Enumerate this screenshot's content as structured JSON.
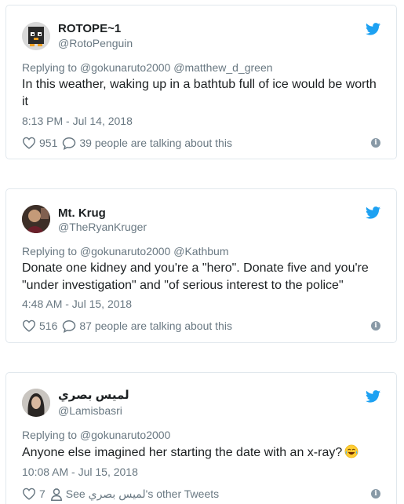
{
  "colors": {
    "twitter_blue": "#1da1f2",
    "gray": "#697882",
    "text": "#1c2022",
    "border": "#e1e8ed"
  },
  "tweets": [
    {
      "display_name": "ROTOPE~1",
      "handle": "@RotoPenguin",
      "replying": "Replying to @gokunaruto2000 @matthew_d_green",
      "text": "In this weather, waking up in a bathtub full of ice would be worth it",
      "timestamp": "8:13 PM - Jul 14, 2018",
      "likes": "951",
      "replies_label": "39 people are talking about this",
      "icons": [
        "heart-icon",
        "speech-bubble-icon",
        "info-icon",
        "twitter-bird-icon"
      ]
    },
    {
      "display_name": "Mt. Krug",
      "handle": "@TheRyanKruger",
      "replying": "Replying to @gokunaruto2000 @Kathbum",
      "text": "Donate one kidney and you're a \"hero\". Donate five and you're \"under investigation\" and \"of serious interest to the police\"",
      "timestamp": "4:48 AM - Jul 15, 2018",
      "likes": "516",
      "replies_label": "87 people are talking about this",
      "icons": [
        "heart-icon",
        "speech-bubble-icon",
        "info-icon",
        "twitter-bird-icon"
      ]
    },
    {
      "display_name": "لميس بصري",
      "handle": "@Lamisbasri",
      "replying": "Replying to @gokunaruto2000",
      "text": "Anyone else imagined her starting the date with an x-ray?",
      "timestamp": "10:08 AM - Jul 15, 2018",
      "likes": "7",
      "replies_label": "See لميس بصري's other Tweets",
      "icons": [
        "heart-icon",
        "person-icon",
        "info-icon",
        "twitter-bird-icon",
        "laughing-tears-emoji"
      ]
    }
  ]
}
